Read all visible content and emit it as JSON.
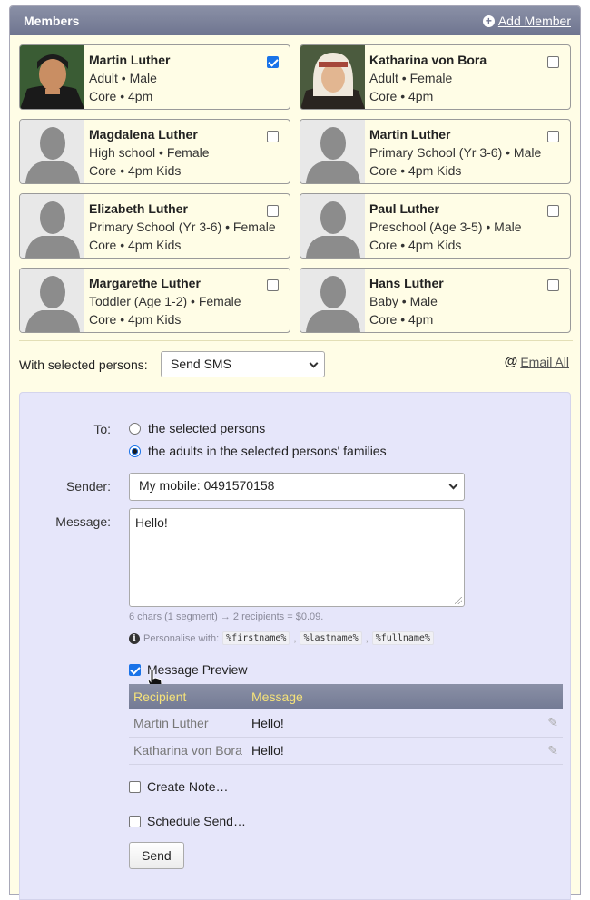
{
  "panel": {
    "title": "Members",
    "add_member_label": "Add Member"
  },
  "members": [
    {
      "name": "Martin Luther",
      "detail": "Adult • Male",
      "group": "Core • 4pm",
      "checked": true,
      "photo": "portrait-martin"
    },
    {
      "name": "Katharina von Bora",
      "detail": "Adult • Female",
      "group": "Core • 4pm",
      "checked": false,
      "photo": "portrait-katharina"
    },
    {
      "name": "Magdalena Luther",
      "detail": "High school • Female",
      "group": "Core • 4pm Kids",
      "checked": false,
      "photo": "silhouette"
    },
    {
      "name": "Martin Luther",
      "detail": "Primary School (Yr 3-6) • Male",
      "group": "Core • 4pm Kids",
      "checked": false,
      "photo": "silhouette"
    },
    {
      "name": "Elizabeth Luther",
      "detail": "Primary School (Yr 3-6) • Female",
      "group": "Core • 4pm Kids",
      "checked": false,
      "photo": "silhouette"
    },
    {
      "name": "Paul Luther",
      "detail": "Preschool (Age 3-5) • Male",
      "group": "Core • 4pm Kids",
      "checked": false,
      "photo": "silhouette"
    },
    {
      "name": "Margarethe Luther",
      "detail": "Toddler (Age 1-2) • Female",
      "group": "Core • 4pm Kids",
      "checked": false,
      "photo": "silhouette"
    },
    {
      "name": "Hans Luther",
      "detail": "Baby • Male",
      "group": "Core • 4pm",
      "checked": false,
      "photo": "silhouette"
    }
  ],
  "bulk": {
    "label": "With selected persons:",
    "action_selected": "Send SMS",
    "email_all_icon": "@",
    "email_all_label": "Email All"
  },
  "sms": {
    "to_label": "To:",
    "to_options": [
      "the selected persons",
      "the adults in the selected persons' families"
    ],
    "to_selected_index": 1,
    "sender_label": "Sender:",
    "sender_value": "My mobile: 0491570158",
    "message_label": "Message:",
    "message_value": "Hello!",
    "stats": "6 chars (1 segment) → 2 recipients = $0.09.",
    "personalise_label": "Personalise with:",
    "tokens": [
      "%firstname%",
      "%lastname%",
      "%fullname%"
    ],
    "preview_label": "Message Preview",
    "preview_checked": true,
    "preview_headers": {
      "recipient": "Recipient",
      "message": "Message"
    },
    "preview_rows": [
      {
        "recipient": "Martin Luther",
        "message": "Hello!"
      },
      {
        "recipient": "Katharina von Bora",
        "message": "Hello!"
      }
    ],
    "create_note_label": "Create Note…",
    "schedule_label": "Schedule Send…",
    "send_label": "Send"
  },
  "colors": {
    "header_bg": "#737a94",
    "card_bg": "#fffde6",
    "sms_bg": "#e6e6fa",
    "table_header_text": "#f5e27a",
    "checkbox_on": "#1a73e8"
  }
}
